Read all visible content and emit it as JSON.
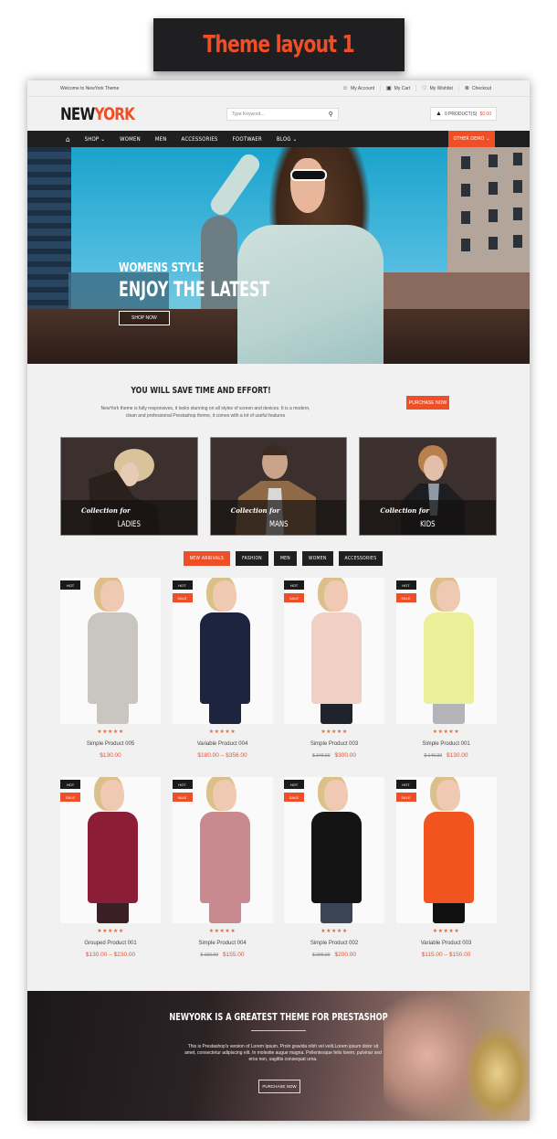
{
  "title_banner": "Theme layout 1",
  "topbar": {
    "welcome": "Welcome to NewYork Theme",
    "links": [
      {
        "label": "My Account",
        "icon": "user-icon",
        "glyph": "☺"
      },
      {
        "label": "My Cart",
        "icon": "bag-icon",
        "glyph": "▣"
      },
      {
        "label": "My Wishlist",
        "icon": "heart-icon",
        "glyph": "♡"
      },
      {
        "label": "Checkout",
        "icon": "checkout-icon",
        "glyph": "⊗"
      }
    ]
  },
  "header": {
    "logo_part1": "NEW",
    "logo_part2": "YORK",
    "search_placeholder": "Type Keyword...",
    "cart_label": "0 PRODUCT(S)",
    "cart_amount": "$0.00"
  },
  "nav": {
    "items": [
      {
        "label": "SHOP",
        "dropdown": true
      },
      {
        "label": "WOMEN",
        "dropdown": false
      },
      {
        "label": "MEN",
        "dropdown": false
      },
      {
        "label": "ACCESSORIES",
        "dropdown": false
      },
      {
        "label": "FOOTWAER",
        "dropdown": false
      },
      {
        "label": "BLOG",
        "dropdown": true
      }
    ],
    "other_demo": "OTHER DEMO"
  },
  "hero": {
    "subtitle": "WOMENS STYLE",
    "title": "ENJOY THE LATEST",
    "button": "SHOP NOW"
  },
  "promo": {
    "heading": "YOU WILL SAVE TIME AND EFFORT!",
    "text": "NewYork theme is fully responsives, it looks stunning on all styles of screen and devices. It is a modern, clean and professional Prestashop theme, it comes with a lot of useful features",
    "button": "PURCHASE NOW"
  },
  "collections": [
    {
      "prefix": "Collection for",
      "name": "LADIES"
    },
    {
      "prefix": "Collection for",
      "name": "MANS"
    },
    {
      "prefix": "Collection for",
      "name": "KIDS"
    }
  ],
  "tabs": [
    {
      "label": "NEW ARRIVALS",
      "active": true
    },
    {
      "label": "FASHION",
      "active": false
    },
    {
      "label": "MEN",
      "active": false
    },
    {
      "label": "WOMEN",
      "active": false
    },
    {
      "label": "ACCESSORIES",
      "active": false
    }
  ],
  "products": [
    {
      "name": "Simple Product 005",
      "price": "$130.00",
      "old_price": "",
      "hot": true,
      "sale": false,
      "rating": 5,
      "top_color": "#c9c6c1",
      "bottom_color": "#c9c6c1"
    },
    {
      "name": "Variable Product 004",
      "price": "$180.00 – $356.00",
      "old_price": "",
      "hot": true,
      "sale": true,
      "rating": 5,
      "top_color": "#1c2440",
      "bottom_color": "#1c2440"
    },
    {
      "name": "Simple Product 003",
      "price": "$300.00",
      "old_price": "$ 340.00",
      "hot": true,
      "sale": true,
      "rating": 5,
      "top_color": "#f1cfc4",
      "bottom_color": "#20232c"
    },
    {
      "name": "Simple Product 001",
      "price": "$130.00",
      "old_price": "$ 140.00",
      "hot": true,
      "sale": true,
      "rating": 5,
      "top_color": "#ecef9a",
      "bottom_color": "#b3b3b8"
    },
    {
      "name": "Grouped Product 001",
      "price": "$130.00 – $230.00",
      "old_price": "",
      "hot": true,
      "sale": true,
      "rating": 5,
      "top_color": "#8c1d36",
      "bottom_color": "#3a2024"
    },
    {
      "name": "Simple Product 004",
      "price": "$155.00",
      "old_price": "$ 160.00",
      "hot": true,
      "sale": true,
      "rating": 5,
      "top_color": "#c98a8f",
      "bottom_color": "#c98a8f"
    },
    {
      "name": "Simple Product 002",
      "price": "$200.00",
      "old_price": "$ 290.00",
      "hot": true,
      "sale": true,
      "rating": 5,
      "top_color": "#141414",
      "bottom_color": "#3b4555"
    },
    {
      "name": "Variable Product 003",
      "price": "$115.00 – $150.00",
      "old_price": "",
      "hot": true,
      "sale": true,
      "rating": 5,
      "top_color": "#f1541f",
      "bottom_color": "#111111"
    }
  ],
  "badges": {
    "hot": "HOT",
    "sale": "SALE"
  },
  "footer_banner": {
    "heading": "NEWYORK IS A GREATEST THEME FOR PRESTASHOP",
    "text": "This is Prestashop's version of Lorem Ipsum. Proin gravida nibh vel velit.Lorem ipsum dolor sit amet, consectetur adipiscing elit. In molestie augue magna. Pellentesque felis lorem, pulvinar sed eros non, sagittis consequat urna.",
    "button": "PURCHASE NOW"
  },
  "colors": {
    "accent": "#ee4f27",
    "dark": "#1f1f1f",
    "background": "#f1f1f1"
  }
}
